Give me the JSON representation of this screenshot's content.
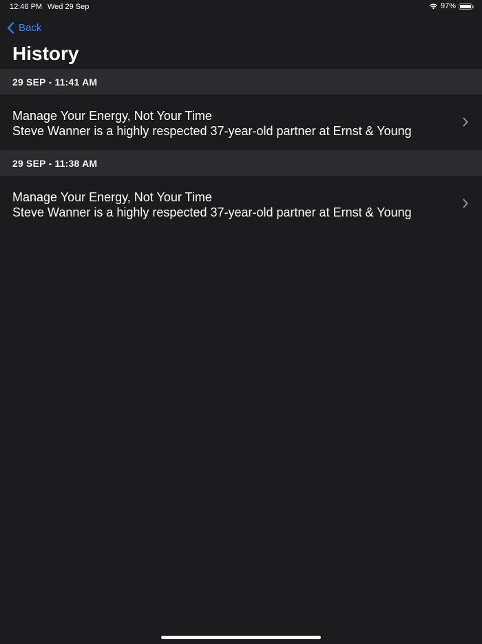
{
  "status_bar": {
    "time": "12:46 PM",
    "date": "Wed 29 Sep",
    "battery_percent": "97%",
    "battery_level": 0.97
  },
  "nav": {
    "back_label": "Back",
    "title": "History"
  },
  "sections": [
    {
      "header": "29 SEP - 11:41 AM",
      "item": {
        "title": "Manage Your Energy, Not Your Time",
        "subtitle": "Steve Wanner is a highly respected 37-year-old partner at Ernst & Young"
      }
    },
    {
      "header": "29 SEP - 11:38 AM",
      "item": {
        "title": "Manage Your Energy, Not Your Time",
        "subtitle": "Steve Wanner is a highly respected 37-year-old partner at Ernst & Young"
      }
    }
  ],
  "colors": {
    "background": "#1c1c1e",
    "section_header": "#2c2c2e",
    "accent": "#2f86f7"
  },
  "icons": [
    "wifi-icon",
    "battery-icon",
    "chevron-left-icon",
    "chevron-right-icon"
  ]
}
